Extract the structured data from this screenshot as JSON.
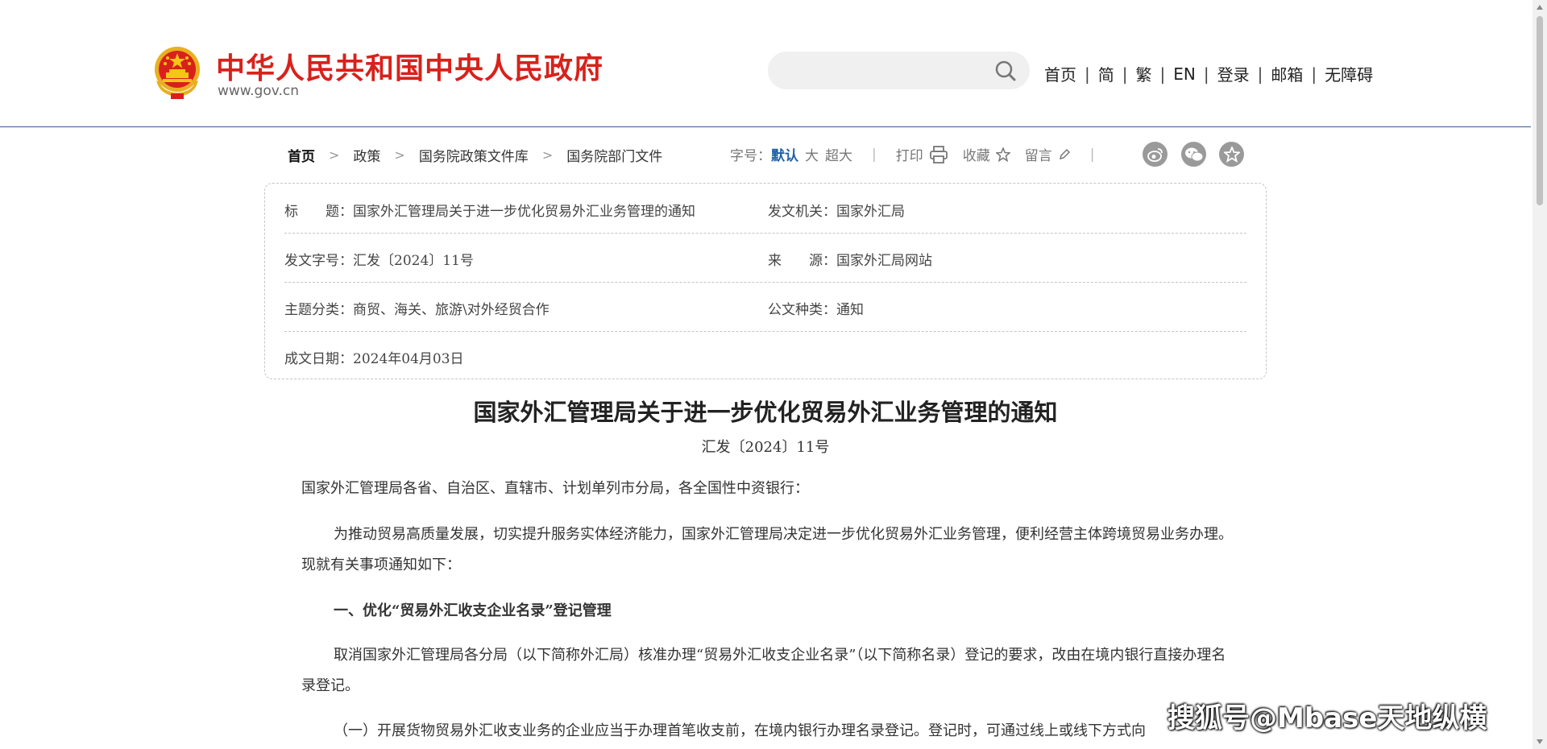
{
  "header": {
    "site_name": "中华人民共和国中央人民政府",
    "site_domain": "www.gov.cn",
    "search": {
      "value": "",
      "placeholder": ""
    },
    "nav": [
      "首页",
      "简",
      "繁",
      "EN",
      "登录",
      "邮箱",
      "无障碍"
    ]
  },
  "breadcrumb": [
    "首页",
    "政策",
    "国务院政策文件库",
    "国务院部门文件"
  ],
  "tools": {
    "font_size_label": "字号：",
    "font_sizes": [
      "默认",
      "大",
      "超大"
    ],
    "print_label": "打印",
    "favorite_label": "收藏",
    "comment_label": "留言"
  },
  "info": {
    "title_label": "标　　题：",
    "title_value": "国家外汇管理局关于进一步优化贸易外汇业务管理的通知",
    "issuer_label": "发文机关：",
    "issuer_value": "国家外汇局",
    "docno_label": "发文字号：",
    "docno_value": "汇发〔2024〕11号",
    "source_label": "来　　源：",
    "source_value": "国家外汇局网站",
    "subject_label": "主题分类：",
    "subject_value": "商贸、海关、旅游\\对外经贸合作",
    "type_label": "公文种类：",
    "type_value": "通知",
    "date_label": "成文日期：",
    "date_value": "2024年04月03日"
  },
  "article": {
    "title": "国家外汇管理局关于进一步优化贸易外汇业务管理的通知",
    "doc_number": "汇发〔2024〕11号",
    "paragraphs": [
      "国家外汇管理局各省、自治区、直辖市、计划单列市分局，各全国性中资银行：",
      "为推动贸易高质量发展，切实提升服务实体经济能力，国家外汇管理局决定进一步优化贸易外汇业务管理，便利经营主体跨境贸易业务办理。现就有关事项通知如下：",
      "一、优化“贸易外汇收支企业名录”登记管理",
      "取消国家外汇管理局各分局（以下简称外汇局）核准办理“贸易外汇收支企业名录”（以下简称名录）登记的要求，改由在境内银行直接办理名录登记。",
      "（一）开展货物贸易外汇收支业务的企业应当于办理首笔收支前，在境内银行办理名录登记。登记时，可通过线上或线下方式向"
    ]
  },
  "watermark": "搜狐号@Mbase天地纵横",
  "colors": {
    "brand_red": "#d9211b",
    "accent_blue": "#1f5fa8",
    "divider": "#3a5a8c"
  }
}
